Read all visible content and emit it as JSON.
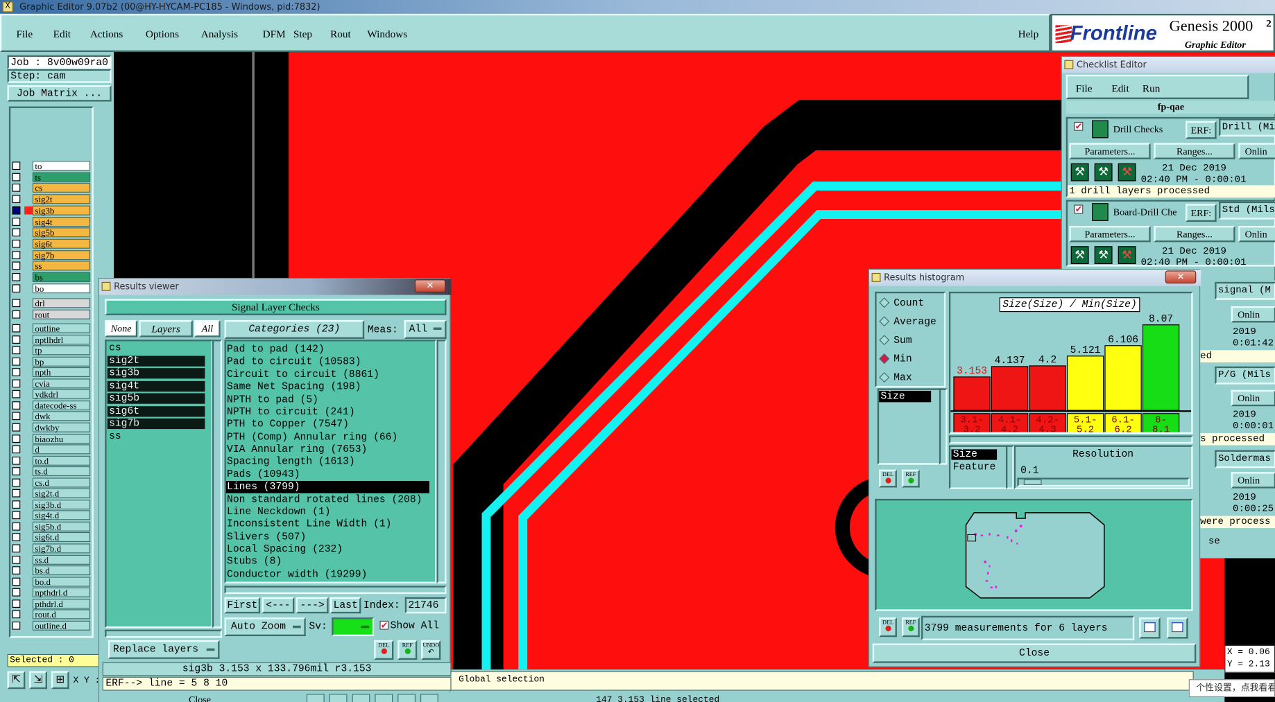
{
  "os": {
    "title": "Graphic Editor 9.07b2 (00@HY-HYCAM-PC185 - Windows, pid:7832)"
  },
  "menubar": {
    "items": [
      "File",
      "Edit",
      "Actions",
      "Options",
      "Analysis",
      "DFM",
      "Step",
      "Rout",
      "Windows"
    ],
    "help": "Help"
  },
  "brand": {
    "logo": "Frontline",
    "product": "Genesis 2000",
    "version": "2",
    "subtitle": "Graphic Editor"
  },
  "job": {
    "job_label": "Job : 8v00w09ra0",
    "step_label": "Step: cam",
    "matrix_button": "Job Matrix ..."
  },
  "layers": {
    "board": [
      {
        "name": "to",
        "color": "#ffffff"
      },
      {
        "name": "ts",
        "color": "#2e9e6a"
      },
      {
        "name": "cs",
        "color": "#f4b842"
      },
      {
        "name": "sig2t",
        "color": "#f4b842"
      },
      {
        "name": "sig3b",
        "color": "#f4b842"
      },
      {
        "name": "sig4t",
        "color": "#f4b842"
      },
      {
        "name": "sig5b",
        "color": "#f4b842"
      },
      {
        "name": "sig6t",
        "color": "#f4b842"
      },
      {
        "name": "sig7b",
        "color": "#f4b842"
      },
      {
        "name": "ss",
        "color": "#f4b842"
      },
      {
        "name": "bs",
        "color": "#2e9e6a"
      },
      {
        "name": "bo",
        "color": "#ffffff"
      }
    ],
    "drill": [
      {
        "name": "drl",
        "color": "#d8d8d8"
      },
      {
        "name": "rout",
        "color": "#d8d8d8"
      }
    ],
    "misc": [
      "outline",
      "nptlhdrl",
      "tp",
      "bp",
      "npth",
      "cvia",
      "ydkdrl",
      "datecode-ss",
      "dwk",
      "dwkby",
      "biaozhu",
      "d",
      "to.d",
      "ts.d",
      "cs.d",
      "sig2t.d",
      "sig3b.d",
      "sig4t.d",
      "sig5b.d",
      "sig6t.d",
      "sig7b.d",
      "ss.d",
      "bs.d",
      "bo.d",
      "npthdrl.d",
      "pthdrl.d",
      "rout.d",
      "outline.d"
    ],
    "selected": "Selected : 0"
  },
  "results_viewer": {
    "title": "Results viewer",
    "heading": "Signal Layer Checks",
    "none": "None",
    "layers": "Layers",
    "all": "All",
    "categories": "Categories (23)",
    "meas_label": "Meas:",
    "meas_value": "All",
    "layer_list": [
      "cs",
      "sig2t",
      "sig3b",
      "sig4t",
      "sig5b",
      "sig6t",
      "sig7b",
      "ss"
    ],
    "results": [
      "Pad to pad (142)",
      "Pad to circuit (10583)",
      "Circuit to circuit (8861)",
      "Same Net Spacing (198)",
      "NPTH to pad (5)",
      "NPTH to circuit (241)",
      "PTH to Copper (7547)",
      "PTH (Comp) Annular ring (66)",
      "VIA Annular ring (7653)",
      "Spacing length (1613)",
      "Pads (10943)",
      "Lines (3799)",
      "Non standard rotated lines (208)",
      "Line Neckdown (1)",
      "Inconsistent Line Width (1)",
      "Slivers (507)",
      "Local Spacing (232)",
      "Stubs (8)",
      "Conductor width (19299)"
    ],
    "selected_result": "Lines (3799)",
    "first": "First",
    "prev": "<---",
    "next": "--->",
    "last": "Last",
    "index_label": "Index:",
    "index_value": "21746",
    "auto_zoom": "Auto Zoom",
    "sv_label": "Sv:",
    "show_all": "Show All",
    "replace_layers": "Replace layers",
    "del": "DEL",
    "ref": "REF",
    "undo": "UNDO",
    "status": "sig3b 3.153 x 133.796mil  r3.153",
    "erf_line": "ERF--> line = 5 8 10",
    "close": "Close"
  },
  "histogram": {
    "title": "Results histogram",
    "options": [
      "Count",
      "Average",
      "Sum",
      "Min",
      "Max"
    ],
    "selected_option": "Min",
    "chart_title": "Size(Size) / Min(Size)",
    "attr": "Size",
    "bin_label": "Size",
    "feature": "Feature",
    "resolution_label": "Resolution",
    "resolution_value": "0.1",
    "del": "DEL",
    "ref": "REF",
    "summary": "3799 measurements for 6 layers",
    "close": "Close"
  },
  "chart_data": {
    "type": "bar",
    "title": "Size(Size) / Min(Size)",
    "categories": [
      "3.1-3.2",
      "4.1-4.2",
      "4.2-4.3",
      "5.1-5.2",
      "6.1-6.2",
      "8-8.1"
    ],
    "values": [
      3.153,
      4.137,
      4.2,
      5.121,
      6.106,
      8.07
    ],
    "colors": [
      "#f01515",
      "#f01515",
      "#f01515",
      "#ffff10",
      "#ffff10",
      "#17dd17"
    ],
    "ylim": [
      0,
      9
    ]
  },
  "checklist": {
    "title": "Checklist Editor",
    "menu": [
      "File",
      "Edit",
      "Run"
    ],
    "name": "fp-qae",
    "drill_checks": "Drill Checks",
    "board_drill": "Board-Drill Che",
    "erf": "ERF:",
    "erf_drill": "Drill (Mi",
    "erf_std": "Std (Mils",
    "parameters": "Parameters...",
    "ranges": "Ranges...",
    "online": "Onlin",
    "date1": "21 Dec 2019",
    "time1": "02:40 PM - 0:00:01",
    "processed1": "1 drill layers processed",
    "date2": "21 Dec 2019",
    "time2": "02:40 PM - 0:00:01",
    "erf_signal": "signal (M",
    "onl2": "Onlin",
    "date3": "2019",
    "time3": "0:01:42",
    "ed": "ed",
    "erf_pg": "P/G (Mils",
    "onl3": "Onlin",
    "date4": "2019",
    "time4": "0:00:01",
    "processed4": "s processed",
    "erf_sm": "Soldermas",
    "onl4": "Onlin",
    "date5": "2019",
    "time5": "0:00:25",
    "processed5": "were process",
    "se": "se"
  },
  "status": {
    "global_selection": "Global selection",
    "bottom_text": "147  3.153 line   selected",
    "x_coord": "X = 0.06",
    "y_coord": "Y = 2.13",
    "xy_label": "X Y :",
    "tooltip": "个性设置，点我看看"
  }
}
